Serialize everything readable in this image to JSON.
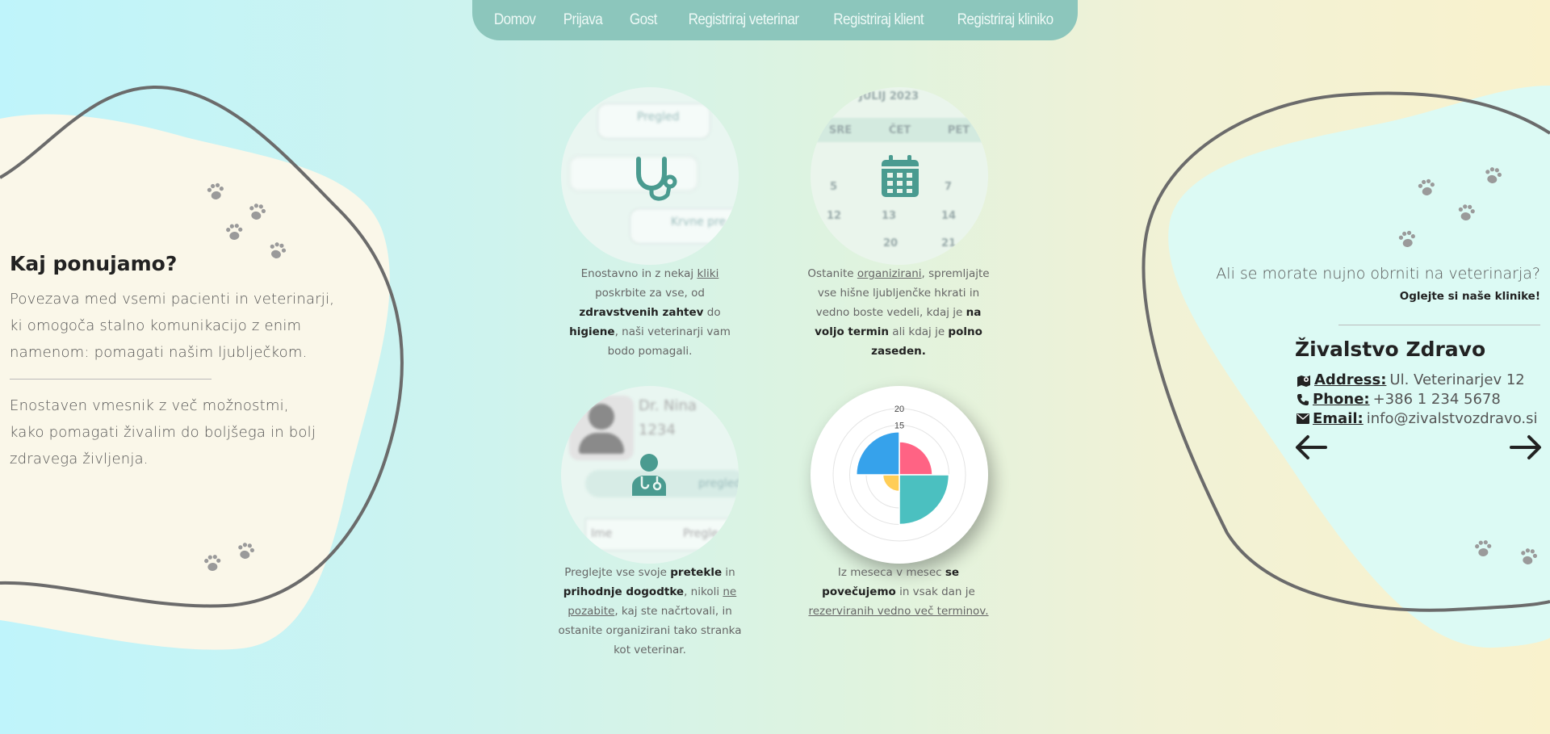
{
  "nav": {
    "items": [
      "Domov",
      "Prijava",
      "Gost",
      "Registriraj veterinar",
      "Registriraj klient",
      "Registriraj kliniko"
    ]
  },
  "left": {
    "title": "Kaj ponujamo?",
    "paragraph1": "Povezava med vsemi pacienti in veterinarji, ki omogoča stalno komunikacijo z enim namenom: pomagati našim ljublječkom.",
    "paragraph2": "Enostaven vmesnik z več možnostmi, kako pomagati živalim do boljšega in bolj zdravega življenja."
  },
  "features": {
    "f1": {
      "bg_items": [
        "Pregled",
        "Krvne pre"
      ],
      "t1": "Enostavno in z nekaj ",
      "link": "kliki",
      "t2": " poskrbite za vse, od ",
      "b1": "zdravstvenih zahtev",
      "t3": " do ",
      "b2": "higiene",
      "t4": ", naši veterinarji vam bodo pomagali."
    },
    "f2": {
      "calendar_month": "JULIJ 2023",
      "calendar_days": [
        "SRE",
        "ČET",
        "PET"
      ],
      "calendar_nums": [
        "5",
        "7",
        "12",
        "13",
        "14",
        "20",
        "21"
      ],
      "t1": "Ostanite ",
      "link": "organizirani",
      "t2": ", spremljajte vse hišne ljubljenčke hkrati in vedno boste vedeli, kdaj je ",
      "b1": "na voljo termin",
      "t3": " ali kdaj je ",
      "b2": "polno zaseden."
    },
    "f3": {
      "bg_name": "Dr. Nina",
      "bg_num": "1234",
      "bg_btn": "pregledam",
      "bg_col1": "Ime",
      "bg_col2": "Pregle",
      "t1": "Preglejte vse svoje ",
      "b1": "pretekle",
      "t2": " in ",
      "b2": "prihodnje dogodtke",
      "t3": ", nikoli ",
      "link": "ne pozabite",
      "t4": ", kaj ste načrtovali, in ostanite organizirani tako stranka kot veterinar."
    },
    "f4": {
      "t1": "Iz meseca v mesec ",
      "b1": "se povečujemo",
      "t2": " in vsak dan je ",
      "link": "rezerviranih vedno več terminov."
    }
  },
  "chart_data": {
    "type": "polar-area",
    "tick_labels": [
      "20",
      "15"
    ],
    "values": [
      10,
      15,
      5,
      13
    ],
    "colors": [
      "#ff6384",
      "#4bc0c0",
      "#ffcd56",
      "#36a2eb"
    ]
  },
  "right": {
    "question": "Ali se morate nujno obrniti na veterinarja?",
    "link": "Oglejte si naše klinike!",
    "clinic_name": "Živalstvo Zdravo",
    "address_label": "Address:",
    "address": "Ul. Veterinarjev 12",
    "phone_label": "Phone:",
    "phone": "+386 1 234 5678",
    "email_label": "Email:",
    "email": "info@zivalstvozdravo.si"
  },
  "icons": {
    "feature1": "stethoscope-icon",
    "feature2": "calendar-icon",
    "feature3": "doctor-icon",
    "paws": "paw-icon",
    "prev": "arrow-left-icon",
    "next": "arrow-right-icon"
  },
  "colors": {
    "nav_bg": "#8cc6bc",
    "icon_teal": "#4a9b90",
    "blob_left": "#faf7e9",
    "blob_right": "#dcfaf4",
    "outline": "#6b6b6b",
    "paw": "#9a9a9a"
  }
}
